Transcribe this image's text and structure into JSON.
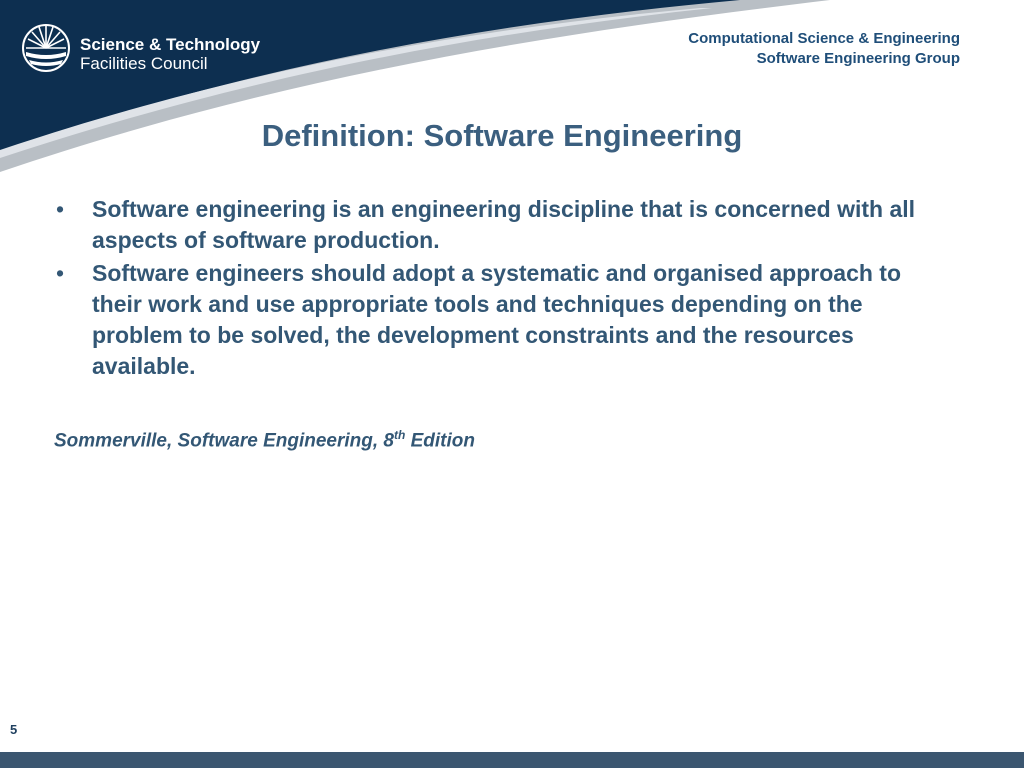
{
  "logo": {
    "line1": "Science & Technology",
    "line2": "Facilities Council"
  },
  "group_heading": {
    "line1": "Computational Science & Engineering",
    "line2": "Software Engineering Group"
  },
  "slide": {
    "title": "Definition: Software Engineering",
    "bullets": [
      "Software engineering is an engineering discipline that is concerned with all aspects of software production.",
      "Software engineers should adopt a systematic and organised approach to their work and use appropriate tools and techniques depending on the problem to be solved, the development constraints and the resources available."
    ],
    "bullet_symbol": "•",
    "citation": {
      "main": "Sommerville, Software Engineering, 8",
      "superscript": "th",
      "suffix": " Edition"
    },
    "page_number": "5"
  },
  "colors": {
    "header_navy": "#0d2f50",
    "header_swoosh_grey": "#b9bfc5",
    "title_text": "#3b5f7f",
    "body_text": "#335775",
    "footer_bar": "#3b5670"
  }
}
